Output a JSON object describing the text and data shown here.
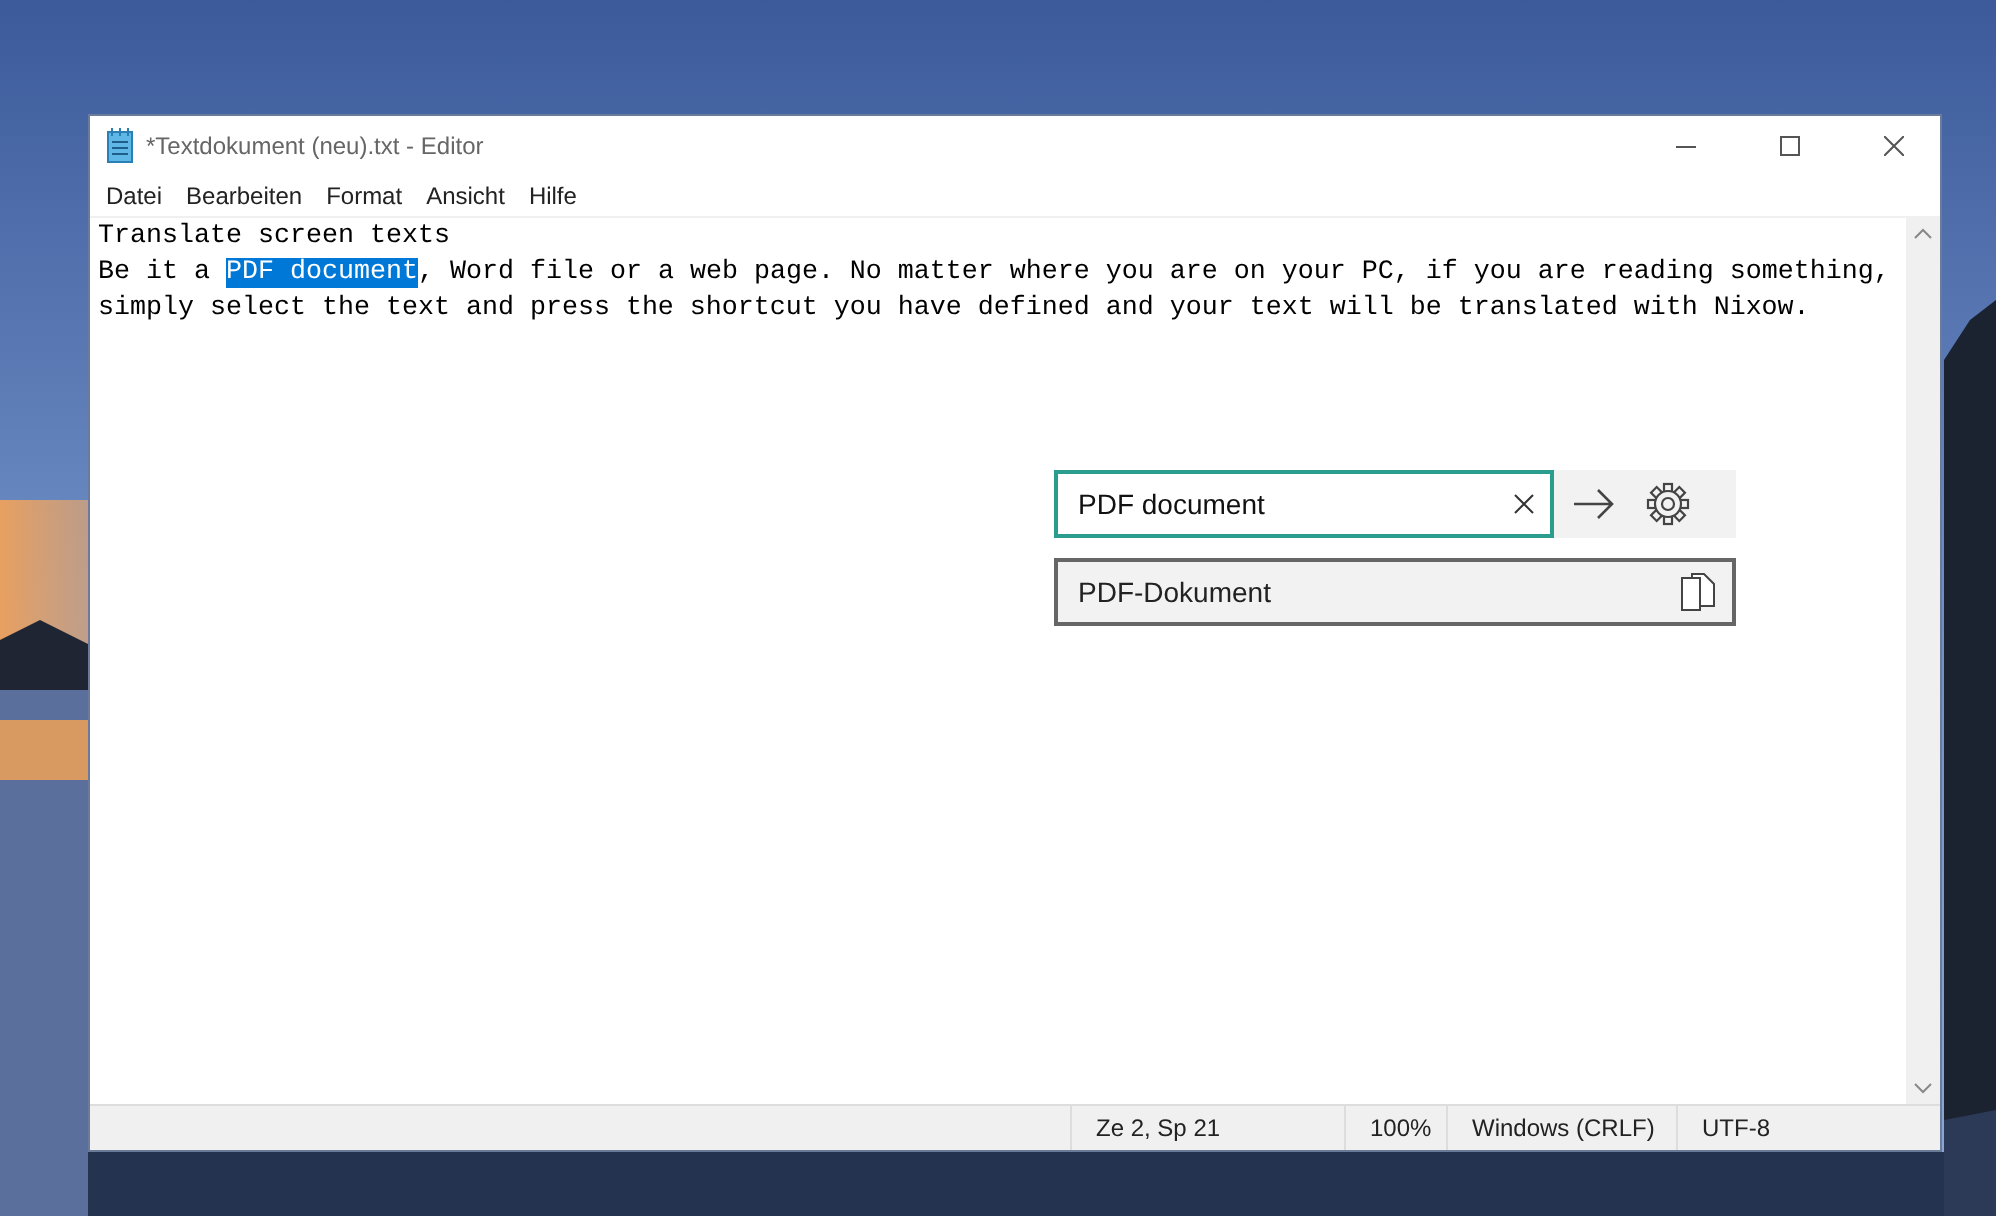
{
  "window": {
    "title": "*Textdokument (neu).txt - Editor"
  },
  "menu": [
    {
      "label": "Datei"
    },
    {
      "label": "Bearbeiten"
    },
    {
      "label": "Format"
    },
    {
      "label": "Ansicht"
    },
    {
      "label": "Hilfe"
    }
  ],
  "editor": {
    "lines": [
      [
        {
          "text": "Translate screen texts",
          "selected": false
        }
      ],
      [
        {
          "text": "Be it a ",
          "selected": false
        },
        {
          "text": "PDF document",
          "selected": true
        },
        {
          "text": ", Word file or a web page. No matter where you are on your PC, if you are reading something,",
          "selected": false
        }
      ],
      [
        {
          "text": "simply select the text and press the shortcut you have defined and your text will be translated with Nixow.",
          "selected": false
        }
      ]
    ]
  },
  "translator": {
    "input": {
      "value": "PDF document"
    },
    "result": "PDF-Dokument"
  },
  "status_bar": [
    "Ze 2, Sp 21",
    "100%",
    "Windows (CRLF)",
    "UTF-8"
  ]
}
